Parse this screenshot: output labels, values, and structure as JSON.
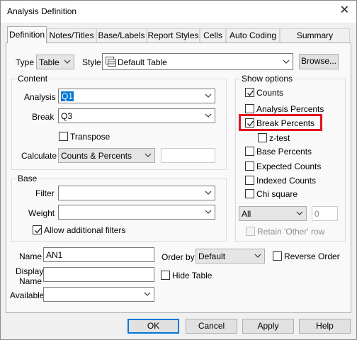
{
  "window": {
    "title": "Analysis Definition",
    "close_glyph": "✕"
  },
  "tabs": [
    {
      "label": "Definition"
    },
    {
      "label": "Notes/Titles"
    },
    {
      "label": "Base/Labels"
    },
    {
      "label": "Report Styles"
    },
    {
      "label": "Cells"
    },
    {
      "label": "Auto Coding"
    },
    {
      "label": "Summary Statistics"
    }
  ],
  "top_row": {
    "type_label": "Type",
    "type_value": "Table",
    "style_label": "Style",
    "style_value": "Default Table",
    "browse_label": "Browse..."
  },
  "content": {
    "title": "Content",
    "analysis_label": "Analysis",
    "analysis_value": "Q1",
    "break_label": "Break",
    "break_value": "Q3",
    "transpose_label": "Transpose",
    "calculate_label": "Calculate",
    "calculate_value": "Counts & Percents",
    "calculate_extra_value": ""
  },
  "base": {
    "title": "Base",
    "filter_label": "Filter",
    "filter_value": "",
    "weight_label": "Weight",
    "weight_value": "",
    "allow_filters_label": "Allow additional filters"
  },
  "show_options": {
    "title": "Show options",
    "items": [
      {
        "label": "Counts",
        "checked": true
      },
      {
        "label": "Analysis Percents",
        "checked": false
      },
      {
        "label": "Break Percents",
        "checked": true
      },
      {
        "label": "z-test",
        "checked": false
      },
      {
        "label": "Base Percents",
        "checked": false
      },
      {
        "label": "Expected Counts",
        "checked": false
      },
      {
        "label": "Indexed Counts",
        "checked": false
      },
      {
        "label": "Chi square",
        "checked": false
      }
    ],
    "all_value": "All",
    "count_value": "0",
    "retain_label": "Retain 'Other' row"
  },
  "bottom": {
    "name_label": "Name",
    "name_value": "AN1",
    "display_name_label_1": "Display",
    "display_name_label_2": "Name",
    "display_name_value": "",
    "available_label": "Available",
    "available_value": "",
    "order_by_label": "Order by",
    "order_by_value": "Default",
    "reverse_order_label": "Reverse Order",
    "hide_table_label": "Hide Table"
  },
  "buttons": {
    "ok": "OK",
    "cancel": "Cancel",
    "apply": "Apply",
    "help": "Help"
  },
  "colors": {
    "accent": "#0078d7",
    "highlight": "#e0141e"
  }
}
